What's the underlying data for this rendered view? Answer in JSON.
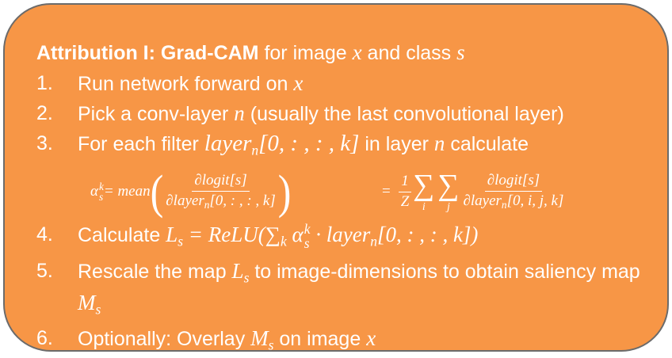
{
  "title": {
    "bold_part": "Attribution I: Grad-CAM",
    "text_a": " for image ",
    "var_x": "x",
    "text_b": " and class ",
    "var_s": "s"
  },
  "steps": [
    {
      "num": "1.",
      "text": "Run network forward on ",
      "var": "x"
    },
    {
      "num": "2.",
      "text_a": "Pick a conv-layer ",
      "var": "n",
      "text_b": " (usually the last convolutional layer)"
    },
    {
      "num": "3.",
      "text_a": "For each filter ",
      "expr": "layer",
      "expr_sub": "n",
      "expr_rest": "[0, : , : , k]",
      "text_b": "  in layer ",
      "var": "n",
      "text_c": " calculate"
    },
    {
      "num": "4.",
      "text_a": "Calculate ",
      "expr_L": "L",
      "expr_L_sub": "s",
      "expr_eq": " = ReLU(∑",
      "expr_k": "k",
      "expr_alpha": " α",
      "expr_alpha_sup": "k",
      "expr_alpha_sub": "s",
      "expr_rest_a": " · layer",
      "expr_rest_sub": "n",
      "expr_rest_b": "[0, : , : , k])"
    },
    {
      "num": "5.",
      "text_a": "Rescale the map ",
      "expr_L": "L",
      "expr_L_sub": "s",
      "text_b": " to image-dimensions to obtain saliency map ",
      "expr_M": "M",
      "expr_M_sub": "s"
    },
    {
      "num": "6.",
      "text_a": "Optionally: Overlay ",
      "expr_M": "M",
      "expr_M_sub": "s",
      "text_b": " on image ",
      "var": "x"
    }
  ],
  "formula": {
    "alpha": "α",
    "alpha_sup": "k",
    "alpha_sub": "s",
    "eq_mean": " = mean",
    "frac1_num": "∂logit[s]",
    "frac1_den_a": "∂layer",
    "frac1_den_sub": "n",
    "frac1_den_b": "[0, : , : , k]",
    "eq2": "=",
    "frac_one_num": "1",
    "frac_one_den": "Z",
    "sum_sym": "∑",
    "sum_i": "i",
    "sum_j": "j",
    "frac2_num": "∂logit[s]",
    "frac2_den_a": "∂layer",
    "frac2_den_sub": "n",
    "frac2_den_b": "[0, i, j, k]",
    "paren_open": "(",
    "paren_close": ")"
  }
}
